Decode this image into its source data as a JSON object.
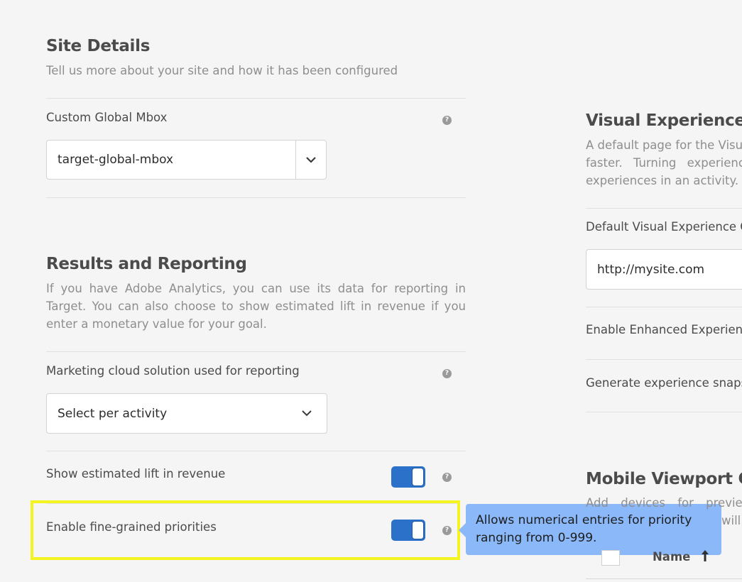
{
  "site_details": {
    "title": "Site Details",
    "description": "Tell us more about your site and how it has been configured",
    "custom_mbox_label": "Custom Global Mbox",
    "custom_mbox_value": "target-global-mbox"
  },
  "results_reporting": {
    "title": "Results and Reporting",
    "description": "If you have Adobe Analytics, you can use its data for reporting in Target. You can also choose to show estimated lift in revenue if you enter a monetary value for your goal.",
    "marketing_cloud_label": "Marketing cloud solution used for reporting",
    "marketing_cloud_value": "Select per activity",
    "estimated_lift_label": "Show estimated lift in revenue",
    "estimated_lift_on": true,
    "fine_grained_label": "Enable fine-grained priorities",
    "fine_grained_on": true
  },
  "tooltip": {
    "text": "Allows numerical entries for priority ranging from 0-999."
  },
  "visual_experience": {
    "title": "Visual Experience Co",
    "description": "A default page for the Visu faster. Turning experience experiences in an activity.",
    "desc_line1": "A default page for the Visu",
    "desc_line2": "faster. Turning experience",
    "desc_line3": "experiences in an activity.",
    "default_url_label": "Default Visual Experience Co",
    "default_url_value": "http://mysite.com",
    "enhanced_label": "Enable Enhanced Experience",
    "snapshot_label": "Generate experience snapsh"
  },
  "mobile_viewport": {
    "title": "Mobile Viewport Con",
    "desc_line1": "Add devices for previe",
    "desc_line2": "will",
    "name_header": "Name"
  },
  "colors": {
    "background": "#f5f5f5",
    "toggle_on": "#2b70c9",
    "tooltip_bg": "#8ab8f8",
    "highlight": "#f4f420"
  },
  "icons": {
    "help": "question-circle-icon",
    "chevron": "chevron-down-icon",
    "sort": "sort-arrow-icon"
  },
  "help_glyph": "?"
}
